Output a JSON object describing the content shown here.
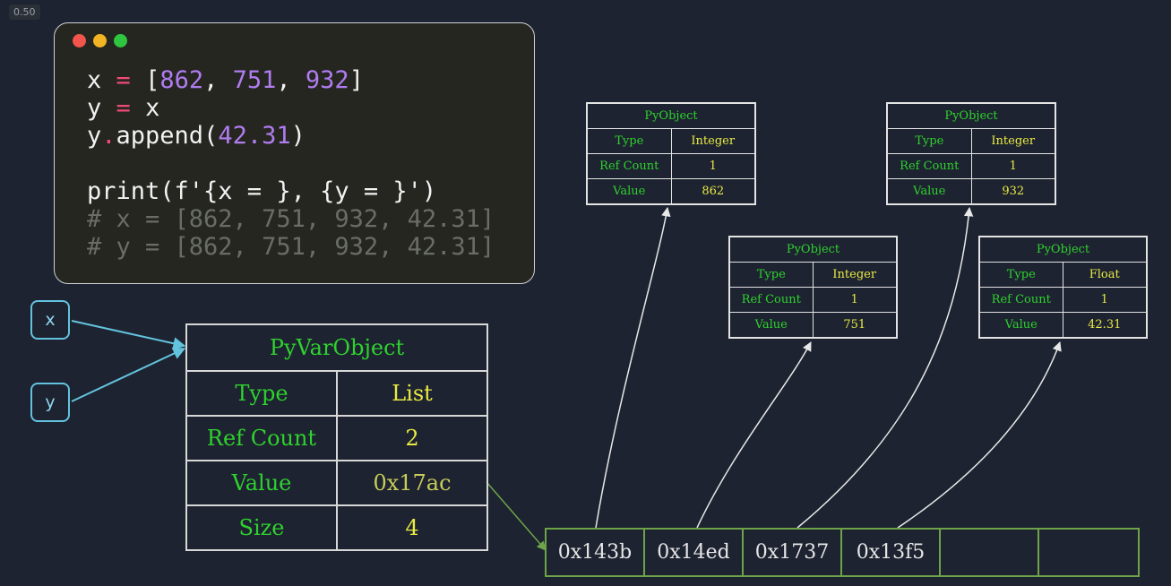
{
  "speed_badge": "0.50",
  "code": {
    "window_dots": [
      "#f2554b",
      "#f3b423",
      "#2ec63f"
    ],
    "line1": {
      "v": "x",
      "eq": "=",
      "open": "[",
      "n1": "862",
      "n2": "751",
      "n3": "932",
      "close": "]"
    },
    "line2": {
      "v": "y",
      "eq": "=",
      "rhs": "x"
    },
    "line3": {
      "obj": "y",
      "dot": ".",
      "fn": "append(",
      "arg": "42.31",
      "close": ")"
    },
    "line4": "print(f'{x = }, {y = }')",
    "comment1": "# x = [862, 751, 932, 42.31]",
    "comment2": "# y = [862, 751, 932, 42.31]"
  },
  "variables": {
    "x": "x",
    "y": "y"
  },
  "list_object": {
    "header": "PyVarObject",
    "rows": [
      {
        "key": "Type",
        "value": "List"
      },
      {
        "key": "Ref Count",
        "value": "2"
      },
      {
        "key": "Value",
        "value": "0x17ac"
      },
      {
        "key": "Size",
        "value": "4"
      }
    ]
  },
  "pointer_array": [
    "0x143b",
    "0x14ed",
    "0x1737",
    "0x13f5",
    "",
    ""
  ],
  "objects": [
    {
      "header": "PyObject",
      "rows": [
        {
          "key": "Type",
          "value": "Integer"
        },
        {
          "key": "Ref Count",
          "value": "1"
        },
        {
          "key": "Value",
          "value": "862"
        }
      ]
    },
    {
      "header": "PyObject",
      "rows": [
        {
          "key": "Type",
          "value": "Integer"
        },
        {
          "key": "Ref Count",
          "value": "1"
        },
        {
          "key": "Value",
          "value": "751"
        }
      ]
    },
    {
      "header": "PyObject",
      "rows": [
        {
          "key": "Type",
          "value": "Integer"
        },
        {
          "key": "Ref Count",
          "value": "1"
        },
        {
          "key": "Value",
          "value": "932"
        }
      ]
    },
    {
      "header": "PyObject",
      "rows": [
        {
          "key": "Type",
          "value": "Float"
        },
        {
          "key": "Ref Count",
          "value": "1"
        },
        {
          "key": "Value",
          "value": "42.31"
        }
      ]
    }
  ]
}
